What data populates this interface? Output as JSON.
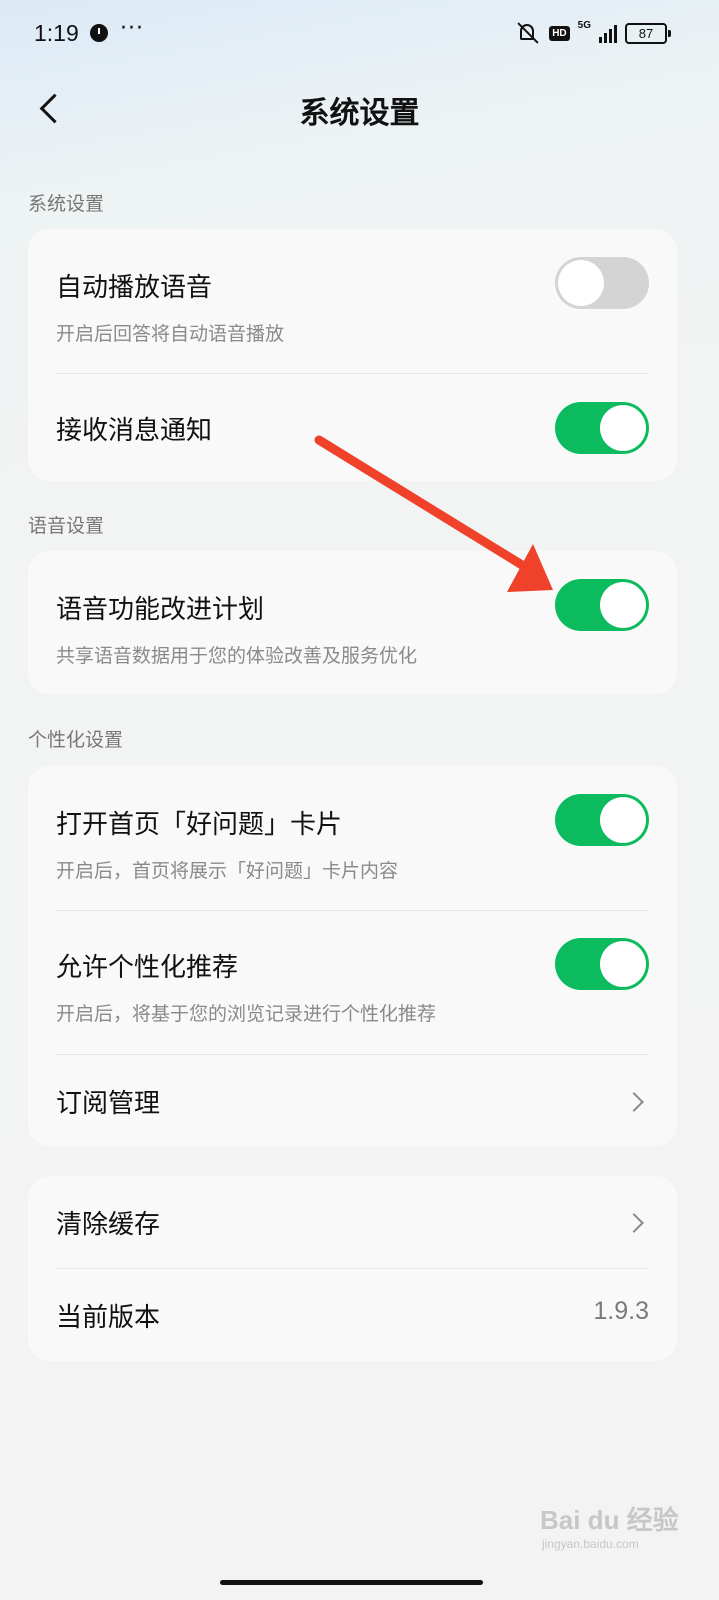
{
  "status_bar": {
    "time": "1:19",
    "dots": "···",
    "hd": "HD",
    "network": "5G",
    "battery": "87"
  },
  "header": {
    "title": "系统设置"
  },
  "sections": {
    "system": {
      "label": "系统设置",
      "items": [
        {
          "title": "自动播放语音",
          "subtitle": "开启后回答将自动语音播放",
          "toggle": false
        },
        {
          "title": "接收消息通知",
          "toggle": true
        }
      ]
    },
    "voice": {
      "label": "语音设置",
      "items": [
        {
          "title": "语音功能改进计划",
          "subtitle": "共享语音数据用于您的体验改善及服务优化",
          "toggle": true
        }
      ]
    },
    "personal": {
      "label": "个性化设置",
      "items": [
        {
          "title": "打开首页「好问题」卡片",
          "subtitle": "开启后，首页将展示「好问题」卡片内容",
          "toggle": true
        },
        {
          "title": "允许个性化推荐",
          "subtitle": "开启后，将基于您的浏览记录进行个性化推荐",
          "toggle": true
        },
        {
          "title": "订阅管理"
        }
      ]
    },
    "other": {
      "items": [
        {
          "title": "清除缓存"
        },
        {
          "title": "当前版本",
          "value": "1.9.3"
        }
      ]
    }
  },
  "colors": {
    "toggle_on": "#0dbb5f",
    "toggle_off": "#d4d4d4",
    "annotation_arrow": "#f0412a"
  },
  "watermark": {
    "brand": "Bai du 经验",
    "url": "jingyan.baidu.com"
  }
}
